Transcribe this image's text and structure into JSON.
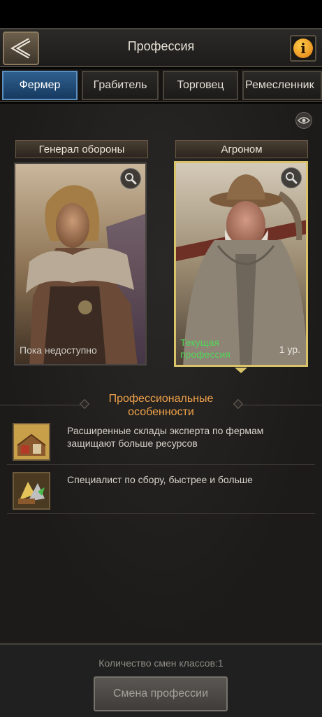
{
  "header": {
    "title": "Профессия"
  },
  "tabs": [
    {
      "label": "Фермер",
      "active": true
    },
    {
      "label": "Грабитель",
      "active": false
    },
    {
      "label": "Торговец",
      "active": false
    },
    {
      "label": "Ремесленник",
      "active": false
    }
  ],
  "cards": [
    {
      "label": "Генерал обороны",
      "status": "Пока недоступно",
      "selected": false,
      "icon": "zoom-icon"
    },
    {
      "label": "Агроном",
      "current_line1": "Текущая",
      "current_line2": "профессия",
      "level": "1 ур.",
      "selected": true,
      "icon": "zoom-icon"
    }
  ],
  "features": {
    "title_line1": "Профессиональные",
    "title_line2": "особенности",
    "items": [
      {
        "text": "Расширенные склады эксперта по фермам защищают больше ресурсов",
        "icon": "warehouse-icon"
      },
      {
        "text": "Специалист по сбору, быстрее и больше",
        "icon": "gather-icon"
      }
    ]
  },
  "footer": {
    "count_text": "Количество смен классов:1",
    "button_label": "Смена профессии"
  },
  "colors": {
    "accent": "#f0a24a",
    "active_tab": "#2f5f8e",
    "current": "#54d35a",
    "selected_border": "#d8c36a"
  }
}
